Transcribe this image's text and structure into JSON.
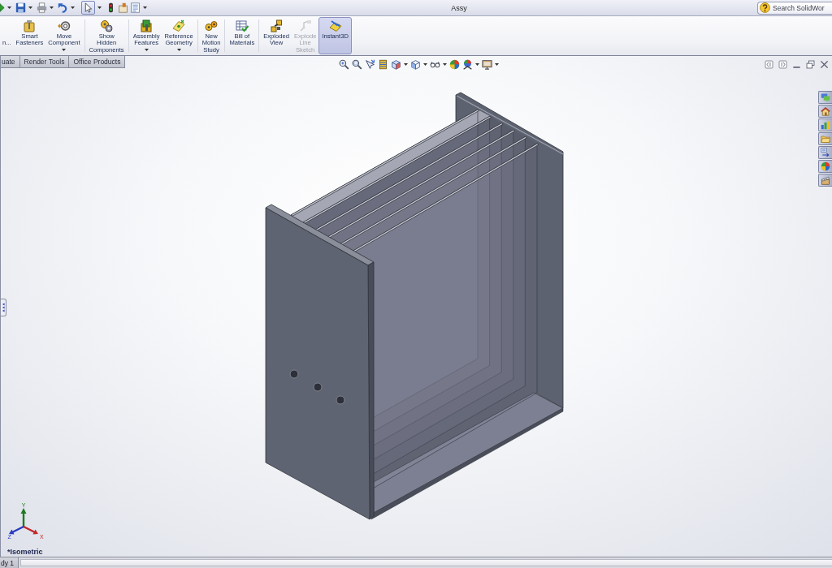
{
  "title_bar": {
    "title": "Assy",
    "search": {
      "placeholder": "Search SolidWor"
    }
  },
  "quick_access_toolbar": [
    {
      "pressed": false
    },
    {
      "pressed": false
    },
    {
      "pressed": false
    },
    {
      "pressed": false
    },
    {
      "pressed": true
    },
    {
      "pressed": false
    },
    {
      "pressed": false
    },
    {
      "pressed": false
    }
  ],
  "ribbon": {
    "groups": [
      {
        "items": [
          {
            "label": "n...",
            "dropdown": false,
            "disabled": false,
            "pressed": false
          },
          {
            "label": "Smart\nFasteners",
            "dropdown": false,
            "disabled": false,
            "pressed": false
          },
          {
            "label": "Move\nComponent",
            "dropdown": true,
            "disabled": false,
            "pressed": false
          }
        ]
      },
      {
        "items": [
          {
            "label": "Show\nHidden\nComponents",
            "dropdown": false,
            "disabled": false,
            "pressed": false
          }
        ]
      },
      {
        "items": [
          {
            "label": "Assembly\nFeatures",
            "dropdown": true,
            "disabled": false,
            "pressed": false
          },
          {
            "label": "Reference\nGeometry",
            "dropdown": true,
            "disabled": false,
            "pressed": false
          }
        ]
      },
      {
        "items": [
          {
            "label": "New\nMotion\nStudy",
            "dropdown": false,
            "disabled": false,
            "pressed": false
          }
        ]
      },
      {
        "items": [
          {
            "label": "Bill of\nMaterials",
            "dropdown": false,
            "disabled": false,
            "pressed": false
          }
        ]
      },
      {
        "items": [
          {
            "label": "Exploded\nView",
            "dropdown": false,
            "disabled": false,
            "pressed": false
          },
          {
            "label": "Explode\nLine\nSketch",
            "dropdown": false,
            "disabled": true,
            "pressed": false
          },
          {
            "label": "Instant3D",
            "dropdown": false,
            "disabled": false,
            "pressed": true
          }
        ]
      }
    ]
  },
  "command_tabs": [
    {
      "label": "uate",
      "selected": false
    },
    {
      "label": "Render Tools",
      "selected": false
    },
    {
      "label": "Office Products",
      "selected": false
    }
  ],
  "viewport": {
    "triad": {
      "x": "X",
      "y": "Y",
      "z": "Z"
    },
    "view_name": "*Isometric"
  },
  "bottom_tabs": [
    {
      "label": "dy 1",
      "selected": false
    }
  ]
}
